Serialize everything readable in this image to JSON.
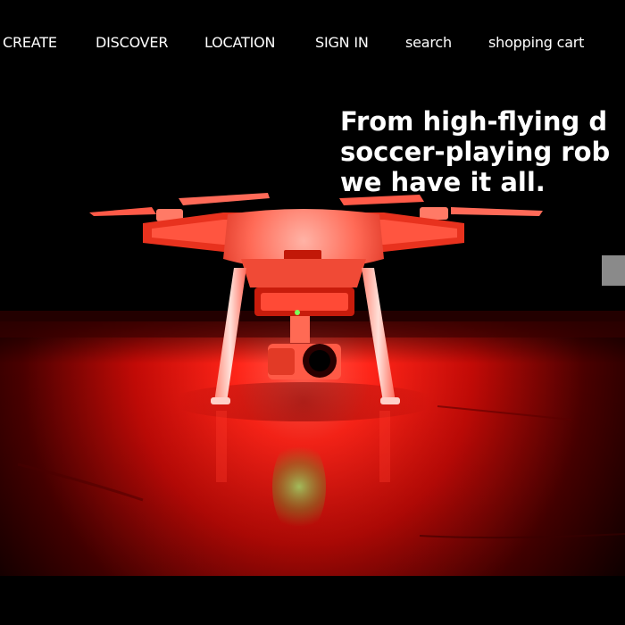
{
  "nav": {
    "items": [
      {
        "label": "CREATE"
      },
      {
        "label": "DISCOVER"
      },
      {
        "label": "LOCATION"
      },
      {
        "label": "SIGN IN"
      },
      {
        "label": "search"
      },
      {
        "label": "shopping cart"
      }
    ]
  },
  "hero": {
    "headline_lines": [
      "From high-flying d",
      "soccer-playing rob",
      "we have it all."
    ],
    "image_subject": "drone-on-red-lit-floor",
    "accent_color": "#ff1a1a",
    "button_color": "#8a8a8a"
  }
}
